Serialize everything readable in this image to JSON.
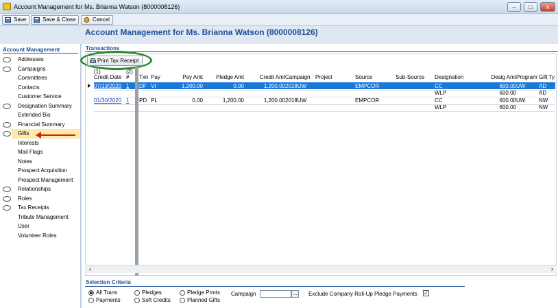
{
  "window": {
    "title": "Account Management for Ms. Brianna Watson (8000008126)",
    "min_label": "–",
    "max_label": "□",
    "close_label": "x"
  },
  "toolbar": {
    "save_label": "Save",
    "save_close_label": "Save & Close",
    "cancel_label": "Cancel"
  },
  "page_title": "Account Management for Ms. Brianna Watson (8000008126)",
  "sidebar": {
    "title": "Account Management",
    "items": [
      {
        "label": "Addresses",
        "bubble": true
      },
      {
        "label": "Campaigns",
        "bubble": true
      },
      {
        "label": "Committees",
        "bubble": false
      },
      {
        "label": "Contacts",
        "bubble": false
      },
      {
        "label": "Customer Service",
        "bubble": false
      },
      {
        "label": "Designation Summary",
        "bubble": true
      },
      {
        "label": "Extended Bio",
        "bubble": false
      },
      {
        "label": "Financial Summary",
        "bubble": true
      },
      {
        "label": "Gifts",
        "bubble": true
      },
      {
        "label": "Interests",
        "bubble": false
      },
      {
        "label": "Mail Flags",
        "bubble": false
      },
      {
        "label": "Notes",
        "bubble": false
      },
      {
        "label": "Prospect Acquisition",
        "bubble": false
      },
      {
        "label": "Prospect Management",
        "bubble": false
      },
      {
        "label": "Relationships",
        "bubble": true
      },
      {
        "label": "Roles",
        "bubble": true
      },
      {
        "label": "Tax Receipts",
        "bubble": true
      },
      {
        "label": "Tribute Management",
        "bubble": false
      },
      {
        "label": "User",
        "bubble": false
      },
      {
        "label": "Volunteer Roles",
        "bubble": false
      }
    ]
  },
  "transactions": {
    "section_title": "Transactions",
    "print_button_label": "Print Tax Receipt",
    "sub_headers": [
      "(1)",
      "(2)"
    ],
    "columns": [
      "Credit Date",
      "#",
      "Txn",
      "Pay",
      "Pay Amt",
      "Pledge Amt",
      "Credit Amt",
      "Campaign",
      "Project",
      "Source",
      "Sub-Source",
      "Designation",
      "Desig Amt",
      "Program",
      "Gift Ty"
    ],
    "rows": [
      {
        "credit_date": "07/13/2020",
        "num": "1",
        "txn": "DF",
        "pay": "VI",
        "pay_amt": "1,200.00",
        "pledge_amt": "0.00",
        "credit_amt": "1,200.00",
        "campaign": "2018UW",
        "project": "",
        "source": "EMPCOR",
        "sub_source": "",
        "designation": "CC",
        "desig_amt": "600.00",
        "program": "UW",
        "gift_type": "AD",
        "selected": true
      },
      {
        "credit_date": "",
        "num": "",
        "txn": "",
        "pay": "",
        "pay_amt": "",
        "pledge_amt": "",
        "credit_amt": "",
        "campaign": "",
        "project": "",
        "source": "",
        "sub_source": "",
        "designation": "WLP",
        "desig_amt": "600.00",
        "program": "",
        "gift_type": "AD",
        "selected": false
      },
      {
        "credit_date": "01/30/2020",
        "num": "1",
        "txn": "PD",
        "pay": "PL",
        "pay_amt": "0.00",
        "pledge_amt": "1,200.00",
        "credit_amt": "1,200.00",
        "campaign": "2018UW",
        "project": "",
        "source": "EMPCOR",
        "sub_source": "",
        "designation": "CC",
        "desig_amt": "600.00",
        "program": "UW",
        "gift_type": "NW",
        "selected": false
      },
      {
        "credit_date": "",
        "num": "",
        "txn": "",
        "pay": "",
        "pay_amt": "",
        "pledge_amt": "",
        "credit_amt": "",
        "campaign": "",
        "project": "",
        "source": "",
        "sub_source": "",
        "designation": "WLP",
        "desig_amt": "600.00",
        "program": "",
        "gift_type": "NW",
        "selected": false
      }
    ],
    "scroll_left": "‹",
    "scroll_right": "›"
  },
  "criteria": {
    "section_title": "Selection Criteria",
    "options": [
      {
        "label": "All Trans",
        "checked": true
      },
      {
        "label": "Payments",
        "checked": false
      },
      {
        "label": "Pledges",
        "checked": false
      },
      {
        "label": "Soft Credits",
        "checked": false
      },
      {
        "label": "Pledge Prmts",
        "checked": false
      },
      {
        "label": "Planned Gifts",
        "checked": false
      }
    ],
    "campaign_label": "Campaign",
    "campaign_value": "",
    "ellipsis_label": "...",
    "exclude_label": "Exclude Company Roll-Up Pledge Payments",
    "exclude_checked_mark": "✓"
  },
  "colors": {
    "accent": "#1f4f9a",
    "selection": "#1a78d6",
    "highlight": "#fde9a9",
    "annotation_arrow": "#cc1f1f",
    "annotation_ring": "#2f8a2f"
  }
}
